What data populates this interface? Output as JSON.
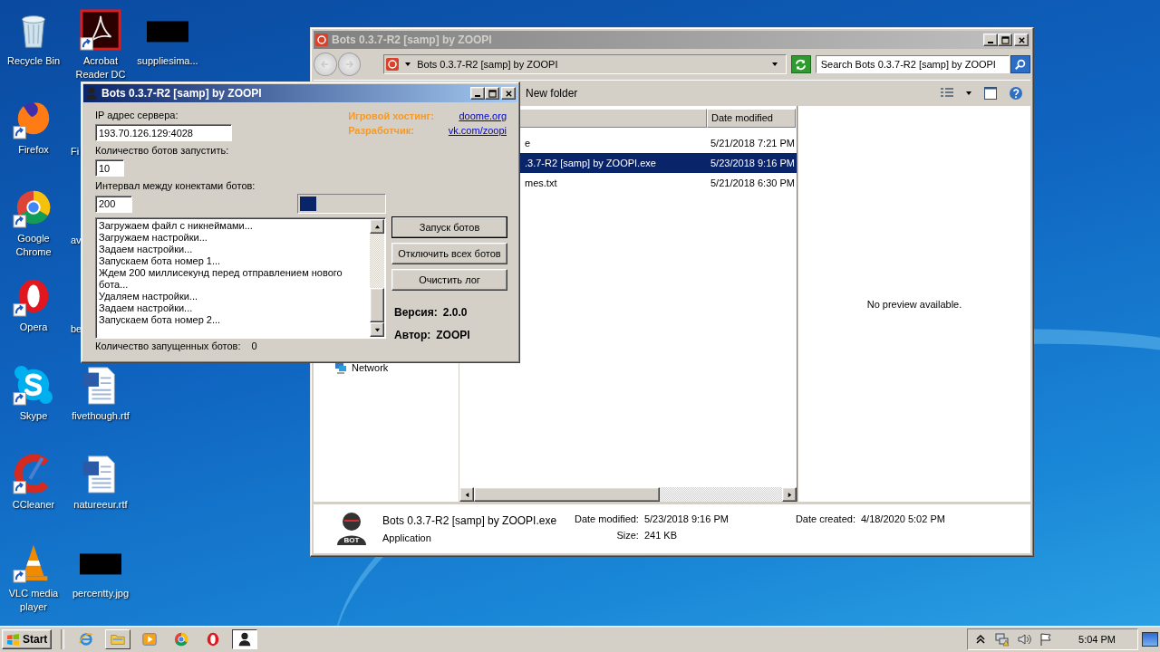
{
  "desktop": {
    "rows": [
      [
        {
          "label": "Recycle Bin",
          "kind": "recycle",
          "shortcut": false
        },
        {
          "label": "Acrobat Reader DC",
          "kind": "pdf",
          "shortcut": true
        },
        {
          "label": "suppliesima...",
          "kind": "redacted",
          "shortcut": false
        }
      ],
      [
        {
          "label": "Firefox",
          "kind": "firefox",
          "shortcut": true
        },
        {
          "label": "Fi",
          "kind": "covered"
        }
      ],
      [
        {
          "label": "Google Chrome",
          "kind": "chrome",
          "shortcut": true
        },
        {
          "label": "av",
          "kind": "covered"
        }
      ],
      [
        {
          "label": "Opera",
          "kind": "opera",
          "shortcut": true
        },
        {
          "label": "be",
          "kind": "covered"
        }
      ],
      [
        {
          "label": "Skype",
          "kind": "skype",
          "shortcut": true
        },
        {
          "label": "fivethough.rtf",
          "kind": "word",
          "shortcut": false
        }
      ],
      [
        {
          "label": "CCleaner",
          "kind": "ccleaner",
          "shortcut": true
        },
        {
          "label": "natureeur.rtf",
          "kind": "word",
          "shortcut": false
        }
      ],
      [
        {
          "label": "VLC media player",
          "kind": "vlc",
          "shortcut": true
        },
        {
          "label": "percentty.jpg",
          "kind": "redacted",
          "shortcut": false
        }
      ]
    ]
  },
  "explorer": {
    "title": "Bots 0.3.7-R2 [samp] by ZOOPI",
    "address": "Bots 0.3.7-R2 [samp] by ZOOPI",
    "search": {
      "placeholder": "Search Bots 0.3.7-R2 [samp] by ZOOPI"
    },
    "toolbar": [
      "New folder"
    ],
    "nav_items": [
      "Network"
    ],
    "columns": [
      "Date modified"
    ],
    "files": [
      {
        "name": "e",
        "date": "5/21/2018 7:21 PM",
        "selected": false
      },
      {
        "name": ".3.7-R2 [samp] by ZOOPI.exe",
        "date": "5/23/2018 9:16 PM",
        "selected": true
      },
      {
        "name": "mes.txt",
        "date": "5/21/2018 6:30 PM",
        "selected": false
      }
    ],
    "preview": "No preview available.",
    "details": {
      "name": "Bots 0.3.7-R2 [samp] by ZOOPI.exe",
      "type": "Application",
      "icon_label": "BOT",
      "columns": [
        [
          {
            "label": "Date modified:",
            "value": "5/23/2018 9:16 PM"
          },
          {
            "label": "Size:",
            "value": "241 KB"
          }
        ],
        [
          {
            "label": "Date created:",
            "value": "4/18/2020 5:02 PM"
          }
        ]
      ]
    }
  },
  "bot_window": {
    "title": "Bots 0.3.7-R2 [samp] by ZOOPI",
    "fields": [
      {
        "label": "IP адрес сервера:",
        "value": "193.70.126.129:4028"
      },
      {
        "label": "Количество ботов запустить:",
        "value": "10"
      },
      {
        "label": "Интервал между конектами ботов:",
        "value": "200"
      }
    ],
    "links": [
      {
        "label": "Игровой хостинг:",
        "link": "doome.org"
      },
      {
        "label": "Разработчик:",
        "link": "vk.com/zoopi"
      }
    ],
    "progress": {
      "level": 0.2
    },
    "log": [
      "Загружаем файл с никнеймами...",
      "Загружаем настройки...",
      "Задаем настройки...",
      "Запускаем бота номер 1...",
      "Ждем 200 миллисекунд перед отправлением нового бота...",
      "Удаляем настройки...",
      "Задаем настройки...",
      "Запускаем бота номер 2..."
    ],
    "buttons": [
      "Запуск ботов",
      "Отключить всех ботов",
      "Очистить лог"
    ],
    "info": [
      {
        "label": "Версия:",
        "value": "2.0.0"
      },
      {
        "label": "Автор:",
        "value": "ZOOPI"
      }
    ],
    "status": {
      "label": "Количество запущенных ботов:",
      "value": "0"
    }
  },
  "taskbar": {
    "start": "Start",
    "items": [
      {
        "kind": "ie",
        "open": false,
        "selected": false
      },
      {
        "kind": "folder",
        "open": true,
        "selected": false
      },
      {
        "kind": "media",
        "open": false,
        "selected": false
      },
      {
        "kind": "chrome",
        "open": false,
        "selected": false
      },
      {
        "kind": "opera",
        "open": false,
        "selected": false
      },
      {
        "kind": "bot",
        "open": true,
        "selected": true
      }
    ],
    "clock": "5:04 PM"
  }
}
